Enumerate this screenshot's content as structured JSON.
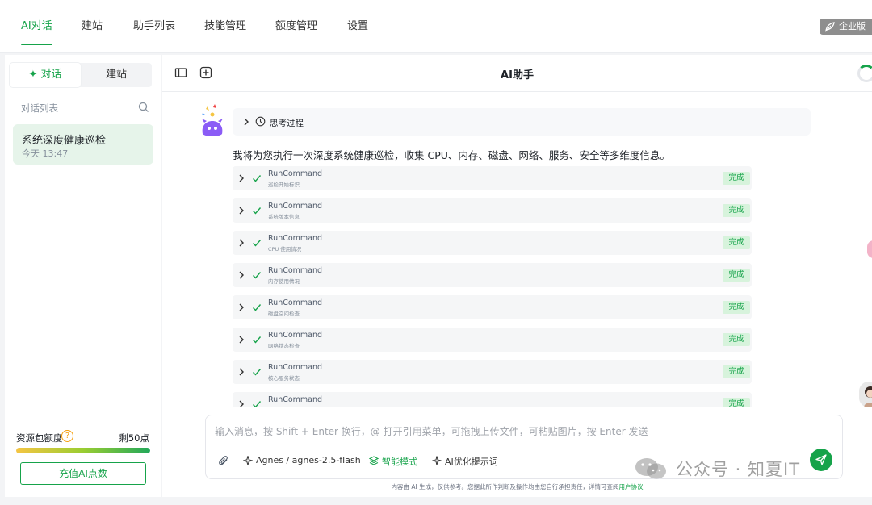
{
  "topnav": {
    "tabs": [
      "AI对话",
      "建站",
      "助手列表",
      "技能管理",
      "额度管理",
      "设置"
    ],
    "enterprise_badge": "企业版"
  },
  "sidebar": {
    "segments": [
      "对话",
      "建站"
    ],
    "list_label": "对话列表",
    "conversation": {
      "title": "系统深度健康巡检",
      "time": "今天 13:47"
    },
    "quota_label": "资源包额度",
    "quota_help": "?",
    "quota_remaining": "剩50点",
    "quota_fill_fraction": 1.0,
    "recharge_label": "充值AI点数"
  },
  "main": {
    "title": "AI助手",
    "thinking_label": "思考过程",
    "intro_text": "我将为您执行一次深度系统健康巡检，收集 CPU、内存、磁盘、网络、服务、安全等多维度信息。",
    "steps": [
      {
        "name": "RunCommand",
        "desc": "巡检开始标识",
        "status": "完成"
      },
      {
        "name": "RunCommand",
        "desc": "系统版本信息",
        "status": "完成"
      },
      {
        "name": "RunCommand",
        "desc": "CPU 使用情况",
        "status": "完成"
      },
      {
        "name": "RunCommand",
        "desc": "内存使用情况",
        "status": "完成"
      },
      {
        "name": "RunCommand",
        "desc": "磁盘空间检查",
        "status": "完成"
      },
      {
        "name": "RunCommand",
        "desc": "网络状态检查",
        "status": "完成"
      },
      {
        "name": "RunCommand",
        "desc": "核心服务状态",
        "status": "完成"
      },
      {
        "name": "RunCommand",
        "desc": "",
        "status": "完成"
      }
    ],
    "composer": {
      "placeholder": "输入消息，按 Shift + Enter 换行，@ 打开引用菜单，可拖拽上传文件，可粘贴图片，按 Enter 发送",
      "model": "Agnes / agnes-2.5-flash",
      "smart_mode": "智能模式",
      "optimize": "AI优化提示词"
    },
    "disclaimer_text": "内容由 AI 生成，仅供参考。您据此所作判断及操作均由您自行承担责任，详情可查阅",
    "disclaimer_link": "用户协议"
  },
  "watermark": "公众号 · 知夏IT",
  "colors": {
    "accent": "#16a34a",
    "badge_bg": "#d7f3dc",
    "active_item_bg": "#e6f4ea"
  }
}
